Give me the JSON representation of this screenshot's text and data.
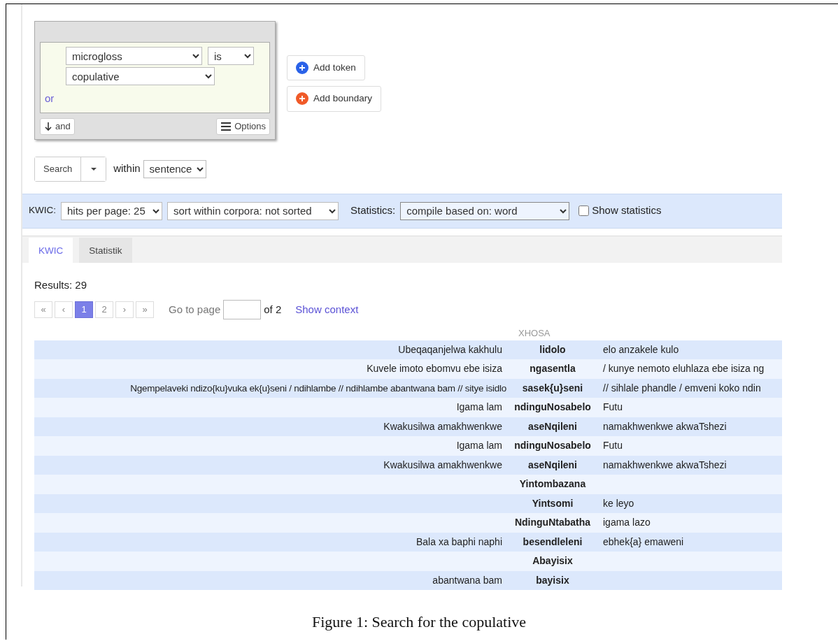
{
  "query_builder": {
    "conditions": [
      {
        "attribute": "microgloss",
        "operator": "is",
        "value": "copulative"
      }
    ],
    "or_label": "or",
    "and_button": "and",
    "options_button": "Options"
  },
  "add_buttons": [
    {
      "label": "Add token",
      "kind": "token"
    },
    {
      "label": "Add boundary",
      "kind": "boundary"
    }
  ],
  "search": {
    "button": "Search",
    "within_label": "within",
    "within_value": "sentence"
  },
  "toolbar": {
    "kwic_label": "KWIC:",
    "hits_per_page": "hits per page: 25",
    "sort": "sort within corpora: not sorted",
    "statistics_label": "Statistics:",
    "compile": "compile based on: word",
    "show_statistics": {
      "label": "Show statistics",
      "checked": false
    }
  },
  "tabs": [
    {
      "label": "KWIC",
      "selected": true
    },
    {
      "label": "Statistik",
      "selected": false
    }
  ],
  "results": "Results: 29",
  "pagination": [
    {
      "label": "«",
      "selected": false
    },
    {
      "label": "‹",
      "selected": false
    },
    {
      "label": "1",
      "selected": true
    },
    {
      "label": "2",
      "selected": false
    },
    {
      "label": "›",
      "selected": false
    },
    {
      "label": "»",
      "selected": false
    }
  ],
  "goto_label": "Go to page",
  "of_label": "of 2",
  "show_context": "Show context",
  "table": {
    "language": "XHOSA",
    "rows": [
      {
        "left": "Ubeqaqanjelwa kakhulu",
        "match": "lidolo",
        "right": "elo anzakele kulo"
      },
      {
        "left": "Kuvele imoto ebomvu ebe isiza",
        "match": "ngasentla",
        "right": "/ kunye nemoto eluhlaza ebe isiza ng"
      },
      {
        "left": "Ngempelaveki ndizo{ku}vuka ek{u}seni / ndihlambe // ndihlambe abantwana bam // sitye isidlo",
        "match": "sasek{u}seni",
        "right": "// sihlale phandle / emveni koko ndin"
      },
      {
        "left": "Igama lam",
        "match": "ndinguNosabelo",
        "right": "Futu"
      },
      {
        "left": "Kwakusilwa amakhwenkwe",
        "match": "aseNqileni",
        "right": "namakhwenkwe akwaTshezi"
      },
      {
        "left": "Igama lam",
        "match": "ndinguNosabelo",
        "right": "Futu"
      },
      {
        "left": "Kwakusilwa amakhwenkwe",
        "match": "aseNqileni",
        "right": "namakhwenkwe akwaTshezi"
      },
      {
        "match": "Yintombazana"
      },
      {
        "match": "Yintsomi",
        "right": "ke leyo"
      },
      {
        "match": "NdinguNtabatha",
        "right": "igama lazo"
      },
      {
        "left": "Bala xa baphi naphi",
        "match": "besendleleni",
        "right": "ebhek{a} emaweni"
      },
      {
        "match": "Abayisix"
      },
      {
        "left": "abantwana bam",
        "match": "bayisix"
      }
    ]
  },
  "caption": "Figure 1: Search for the copulative"
}
